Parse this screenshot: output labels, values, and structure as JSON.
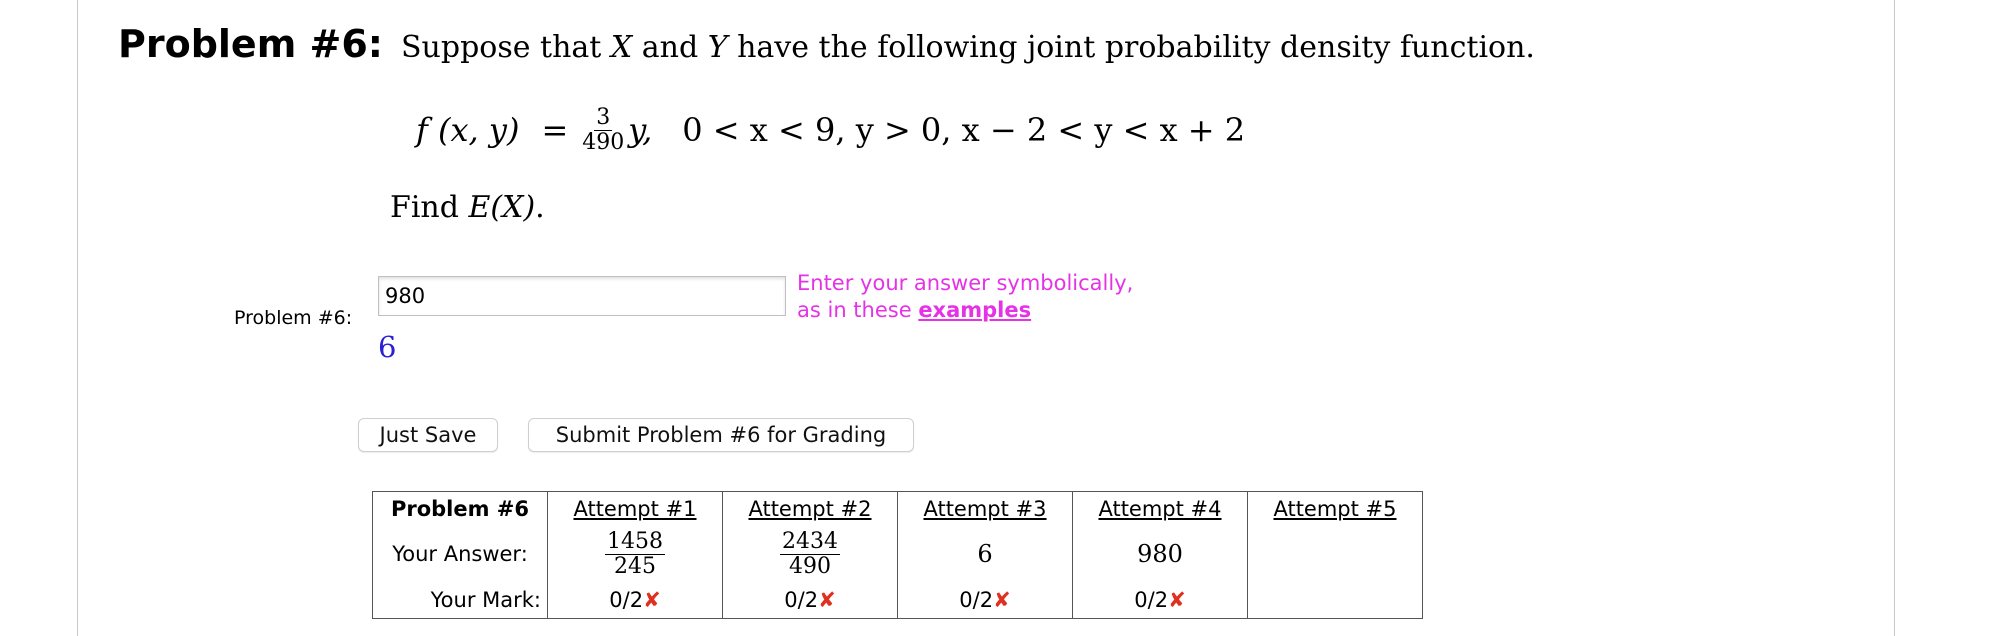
{
  "problem": {
    "title": "Problem #6:",
    "statement_pre": "Suppose that ",
    "var_x": "X",
    "statement_mid": " and ",
    "var_y": "Y",
    "statement_post": " have the following joint probability density function.",
    "formula": {
      "lhs": "f (x, y)",
      "eq": "=",
      "frac_num": "3",
      "frac_den": "490",
      "var": "y,",
      "domain": "0 < x < 9,  y > 0,  x − 2 < y < x + 2"
    },
    "find_prefix": "Find ",
    "find_expr": "E(X)",
    "find_suffix": "."
  },
  "answer": {
    "side_label": "Problem #6:",
    "input_value": "980",
    "hint_line1": "Enter your answer symbolically,",
    "hint_line2": "as in these ",
    "hint_link": "examples",
    "preview": "6"
  },
  "buttons": {
    "save": "Just Save",
    "submit": "Submit Problem #6 for Grading"
  },
  "attempts_table": {
    "header_label": "Problem #6",
    "answer_label": "Your Answer:",
    "mark_label": "Your Mark:",
    "attempts": [
      {
        "label": "Attempt #1",
        "answer_num": "1458",
        "answer_den": "245",
        "mark": "0/2"
      },
      {
        "label": "Attempt #2",
        "answer_num": "2434",
        "answer_den": "490",
        "mark": "0/2"
      },
      {
        "label": "Attempt #3",
        "answer": "6",
        "mark": "0/2"
      },
      {
        "label": "Attempt #4",
        "answer": "980",
        "mark": "0/2"
      },
      {
        "label": "Attempt #5",
        "answer": "",
        "mark": ""
      }
    ],
    "x_mark": "✘",
    "colors": {
      "x_mark": "#e03020"
    }
  },
  "colors": {
    "hint": "#e632e6",
    "preview": "#2b1fd6"
  }
}
